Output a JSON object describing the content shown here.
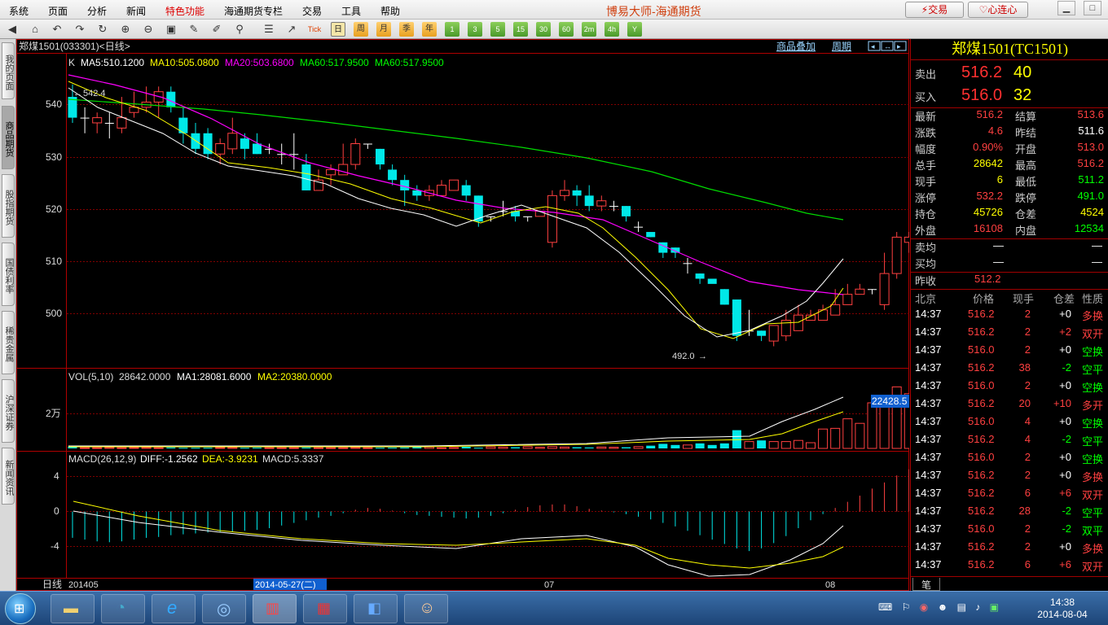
{
  "menu": {
    "items": [
      "系统",
      "页面",
      "分析",
      "新闻",
      "特色功能",
      "海通期货专栏",
      "交易",
      "工具",
      "帮助"
    ],
    "title": "博易大师-海通期货",
    "trade_btn": "交易",
    "heart_btn": "心连心"
  },
  "toolbar": {
    "periods": [
      "日",
      "周",
      "月",
      "季",
      "年",
      "1",
      "3",
      "5",
      "15",
      "30",
      "60",
      "2m",
      "4h",
      "Y"
    ],
    "tick_label": "Tick"
  },
  "left_tabs": [
    "我的页面",
    "商品期货",
    "股指期货",
    "国债利率",
    "稀贵金属",
    "沪深证券",
    "新闻资讯"
  ],
  "chart": {
    "title": "郑煤1501(033301)<日线>",
    "link1": "商品叠加",
    "link2": "周期",
    "ma_line": {
      "k": "K",
      "ma5": "MA5:510.1200",
      "ma10": "MA10:505.0800",
      "ma20": "MA20:503.6800",
      "ma60a": "MA60:517.9500",
      "ma60b": "MA60:517.9500"
    },
    "y_labels": [
      "540",
      "530",
      "520",
      "510",
      "500"
    ],
    "high_mark": "542.4",
    "low_mark": "492.0",
    "vol_line": {
      "label": "VOL(5,10)",
      "value": "28642.0000",
      "ma1": "MA1:28081.6000",
      "ma2": "MA2:20380.0000"
    },
    "vol_y": "2万",
    "vol_current": "22428.5",
    "macd_line": {
      "label": "MACD(26,12,9)",
      "diff": "DIFF:-1.2562",
      "dea": "DEA:-3.9231",
      "macd": "MACD:5.3337"
    },
    "macd_y": [
      "4",
      "0",
      "-4"
    ],
    "date_bar": {
      "period": "日线",
      "start": "201405",
      "cursor": "2014-05-27(二)",
      "m7": "07",
      "m8": "08"
    }
  },
  "chart_data": {
    "type": "candlestick",
    "price_ylim": [
      488,
      548
    ],
    "candles": [
      [
        540,
        536,
        542.4,
        535
      ],
      [
        536,
        536,
        538,
        533
      ],
      [
        535,
        536,
        537,
        533
      ],
      [
        535,
        535,
        537,
        532
      ],
      [
        534,
        536,
        540,
        533
      ],
      [
        537,
        538,
        541,
        536
      ],
      [
        538,
        539,
        542,
        537
      ],
      [
        539,
        541,
        542,
        536
      ],
      [
        541,
        538,
        542,
        537
      ],
      [
        536,
        533,
        538,
        531
      ],
      [
        533,
        530,
        535,
        529
      ],
      [
        533,
        529,
        534,
        528
      ],
      [
        529,
        531,
        532,
        527
      ],
      [
        530,
        533,
        536,
        529
      ],
      [
        532,
        530,
        533,
        528
      ],
      [
        531,
        529,
        533,
        529
      ],
      [
        530,
        530,
        531,
        529
      ],
      [
        529,
        529,
        531,
        527
      ],
      [
        529,
        529,
        533,
        526
      ],
      [
        527,
        522,
        529,
        522
      ],
      [
        522,
        524,
        526,
        522
      ],
      [
        525,
        526,
        527,
        523
      ],
      [
        525,
        527,
        531,
        525
      ],
      [
        527,
        531,
        532,
        526
      ],
      [
        531,
        531,
        531,
        530
      ],
      [
        530,
        527,
        530,
        526
      ],
      [
        526,
        524,
        527,
        523
      ],
      [
        524,
        522,
        525,
        519
      ],
      [
        522,
        521,
        523,
        520
      ],
      [
        521,
        522,
        523,
        520
      ],
      [
        521,
        523,
        524,
        521
      ],
      [
        522,
        524,
        524,
        522
      ],
      [
        523,
        521,
        524,
        520
      ],
      [
        521,
        516,
        521,
        515
      ],
      [
        517,
        517,
        517,
        516
      ],
      [
        518,
        518,
        520,
        517
      ],
      [
        518,
        517,
        519,
        516
      ],
      [
        517,
        517,
        517,
        516
      ],
      [
        517,
        518,
        518,
        517
      ],
      [
        512,
        521,
        522,
        511
      ],
      [
        521,
        522,
        524,
        520
      ],
      [
        522,
        521,
        523,
        519
      ],
      [
        521,
        519,
        523,
        518
      ],
      [
        519,
        520,
        521,
        518
      ],
      [
        519,
        519,
        520,
        518
      ],
      [
        519,
        517,
        519,
        516
      ],
      [
        515,
        515,
        516,
        514
      ],
      [
        514,
        513,
        514,
        513
      ],
      [
        512,
        510,
        512,
        509
      ],
      [
        511,
        510,
        511,
        509
      ],
      [
        508,
        508,
        509,
        506
      ],
      [
        506,
        505,
        506,
        504
      ],
      [
        505,
        504,
        505,
        505
      ],
      [
        503,
        500,
        503,
        500
      ],
      [
        501,
        494,
        501,
        493
      ],
      [
        495,
        495,
        499,
        494
      ],
      [
        495,
        494,
        495,
        493
      ],
      [
        493,
        496,
        496,
        492
      ],
      [
        494,
        497,
        499,
        493
      ],
      [
        495,
        498,
        500,
        495
      ],
      [
        497,
        498,
        499,
        497
      ],
      [
        497,
        499,
        500,
        497
      ],
      [
        498,
        500,
        503,
        498
      ],
      [
        500,
        502,
        504,
        500
      ],
      [
        502,
        503,
        504,
        502
      ],
      [
        503,
        503,
        503,
        502
      ],
      [
        500,
        506,
        510,
        499
      ],
      [
        506,
        513,
        514,
        505
      ],
      [
        512,
        513,
        514,
        510
      ],
      [
        513,
        516,
        517,
        511
      ],
      [
        514,
        516.2,
        517,
        513
      ]
    ],
    "volume": [
      800,
      300,
      300,
      400,
      300,
      350,
      400,
      300,
      400,
      300,
      300,
      300,
      350,
      400,
      300,
      350,
      300,
      300,
      300,
      400,
      300,
      300,
      300,
      400,
      300,
      300,
      350,
      400,
      500,
      600,
      300,
      400,
      700,
      300,
      700,
      600,
      500,
      800,
      500,
      800,
      600,
      500,
      400,
      600,
      500,
      500,
      800,
      1200,
      2000,
      1500,
      1500,
      2200,
      1500,
      2200,
      8000,
      3000,
      3500,
      3000,
      3000,
      3500,
      2500,
      8500,
      8800,
      13000,
      11000,
      20000,
      20000,
      27000,
      24000,
      22500
    ],
    "macd": [
      -3,
      -3.2,
      -3.4,
      -3.5,
      -3.4,
      -3.2,
      -3,
      -2.9,
      -2.7,
      -2.6,
      -2.5,
      -2.4,
      -2.3,
      -2.3,
      -2.2,
      -2.1,
      -1.9,
      -1.6,
      -1.3,
      -1,
      -0.7,
      -0.5,
      -0.2,
      0.2,
      0.4,
      0.3,
      0.1,
      -0.2,
      -0.4,
      -0.5,
      -0.6,
      -0.7,
      -0.8,
      -0.7,
      -0.5,
      -0.2,
      0.2,
      0.5,
      0.7,
      0.8,
      0.8,
      0.6,
      0.3,
      0.1,
      -0.1,
      -0.3,
      -0.6,
      -0.9,
      -1.3,
      -1.7,
      -2.2,
      -2.7,
      -3.2,
      -3.7,
      -4.2,
      -4.5,
      -4.2,
      -3.6,
      -2.8,
      -1.9,
      -1,
      -0.3,
      0.4,
      1.1,
      1.8,
      2.6,
      3.3,
      4.1,
      4.8,
      5.3337
    ]
  },
  "quote": {
    "title": "郑煤1501(TC1501)",
    "sell_label": "卖出",
    "sell_price": "516.2",
    "sell_vol": "40",
    "buy_label": "买入",
    "buy_price": "516.0",
    "buy_vol": "32",
    "rows": [
      [
        "最新",
        "516.2",
        "up",
        "结算",
        "513.6",
        "up"
      ],
      [
        "涨跌",
        "4.6",
        "up",
        "昨结",
        "511.6",
        "wt"
      ],
      [
        "幅度",
        "0.90%",
        "up",
        "开盘",
        "513.0",
        "up"
      ],
      [
        "总手",
        "28642",
        "yl",
        "最高",
        "516.2",
        "up"
      ],
      [
        "现手",
        "6",
        "yl",
        "最低",
        "511.2",
        "dn"
      ],
      [
        "涨停",
        "532.2",
        "up",
        "跌停",
        "491.0",
        "dn"
      ],
      [
        "持仓",
        "45726",
        "yl",
        "仓差",
        "4524",
        "yl"
      ],
      [
        "外盘",
        "16108",
        "up",
        "内盘",
        "12534",
        "dn"
      ]
    ],
    "avg_sell_label": "卖均",
    "avg_sell": "—",
    "avg_sell2": "—",
    "avg_buy_label": "买均",
    "avg_buy": "—",
    "avg_buy2": "—",
    "prev_close_label": "昨收",
    "prev_close": "512.2",
    "tick_headers": [
      "北京",
      "价格",
      "现手",
      "仓差",
      "性质"
    ],
    "ticks": [
      [
        "14:37",
        "516.2",
        "2",
        "+0",
        "多换"
      ],
      [
        "14:37",
        "516.2",
        "2",
        "+2",
        "双开"
      ],
      [
        "14:37",
        "516.0",
        "2",
        "+0",
        "空换"
      ],
      [
        "14:37",
        "516.2",
        "38",
        "-2",
        "空平"
      ],
      [
        "14:37",
        "516.0",
        "2",
        "+0",
        "空换"
      ],
      [
        "14:37",
        "516.2",
        "20",
        "+10",
        "多开"
      ],
      [
        "14:37",
        "516.0",
        "4",
        "+0",
        "空换"
      ],
      [
        "14:37",
        "516.2",
        "4",
        "-2",
        "空平"
      ],
      [
        "14:37",
        "516.0",
        "2",
        "+0",
        "空换"
      ],
      [
        "14:37",
        "516.2",
        "2",
        "+0",
        "多换"
      ],
      [
        "14:37",
        "516.2",
        "6",
        "+6",
        "双开"
      ],
      [
        "14:37",
        "516.2",
        "28",
        "-2",
        "空平"
      ],
      [
        "14:37",
        "516.0",
        "2",
        "-2",
        "双平"
      ],
      [
        "14:37",
        "516.2",
        "2",
        "+0",
        "多换"
      ],
      [
        "14:37",
        "516.2",
        "6",
        "+6",
        "双开"
      ]
    ],
    "bottom_tab": "笔"
  },
  "taskbar": {
    "time": "14:38",
    "date": "2014-08-04"
  }
}
